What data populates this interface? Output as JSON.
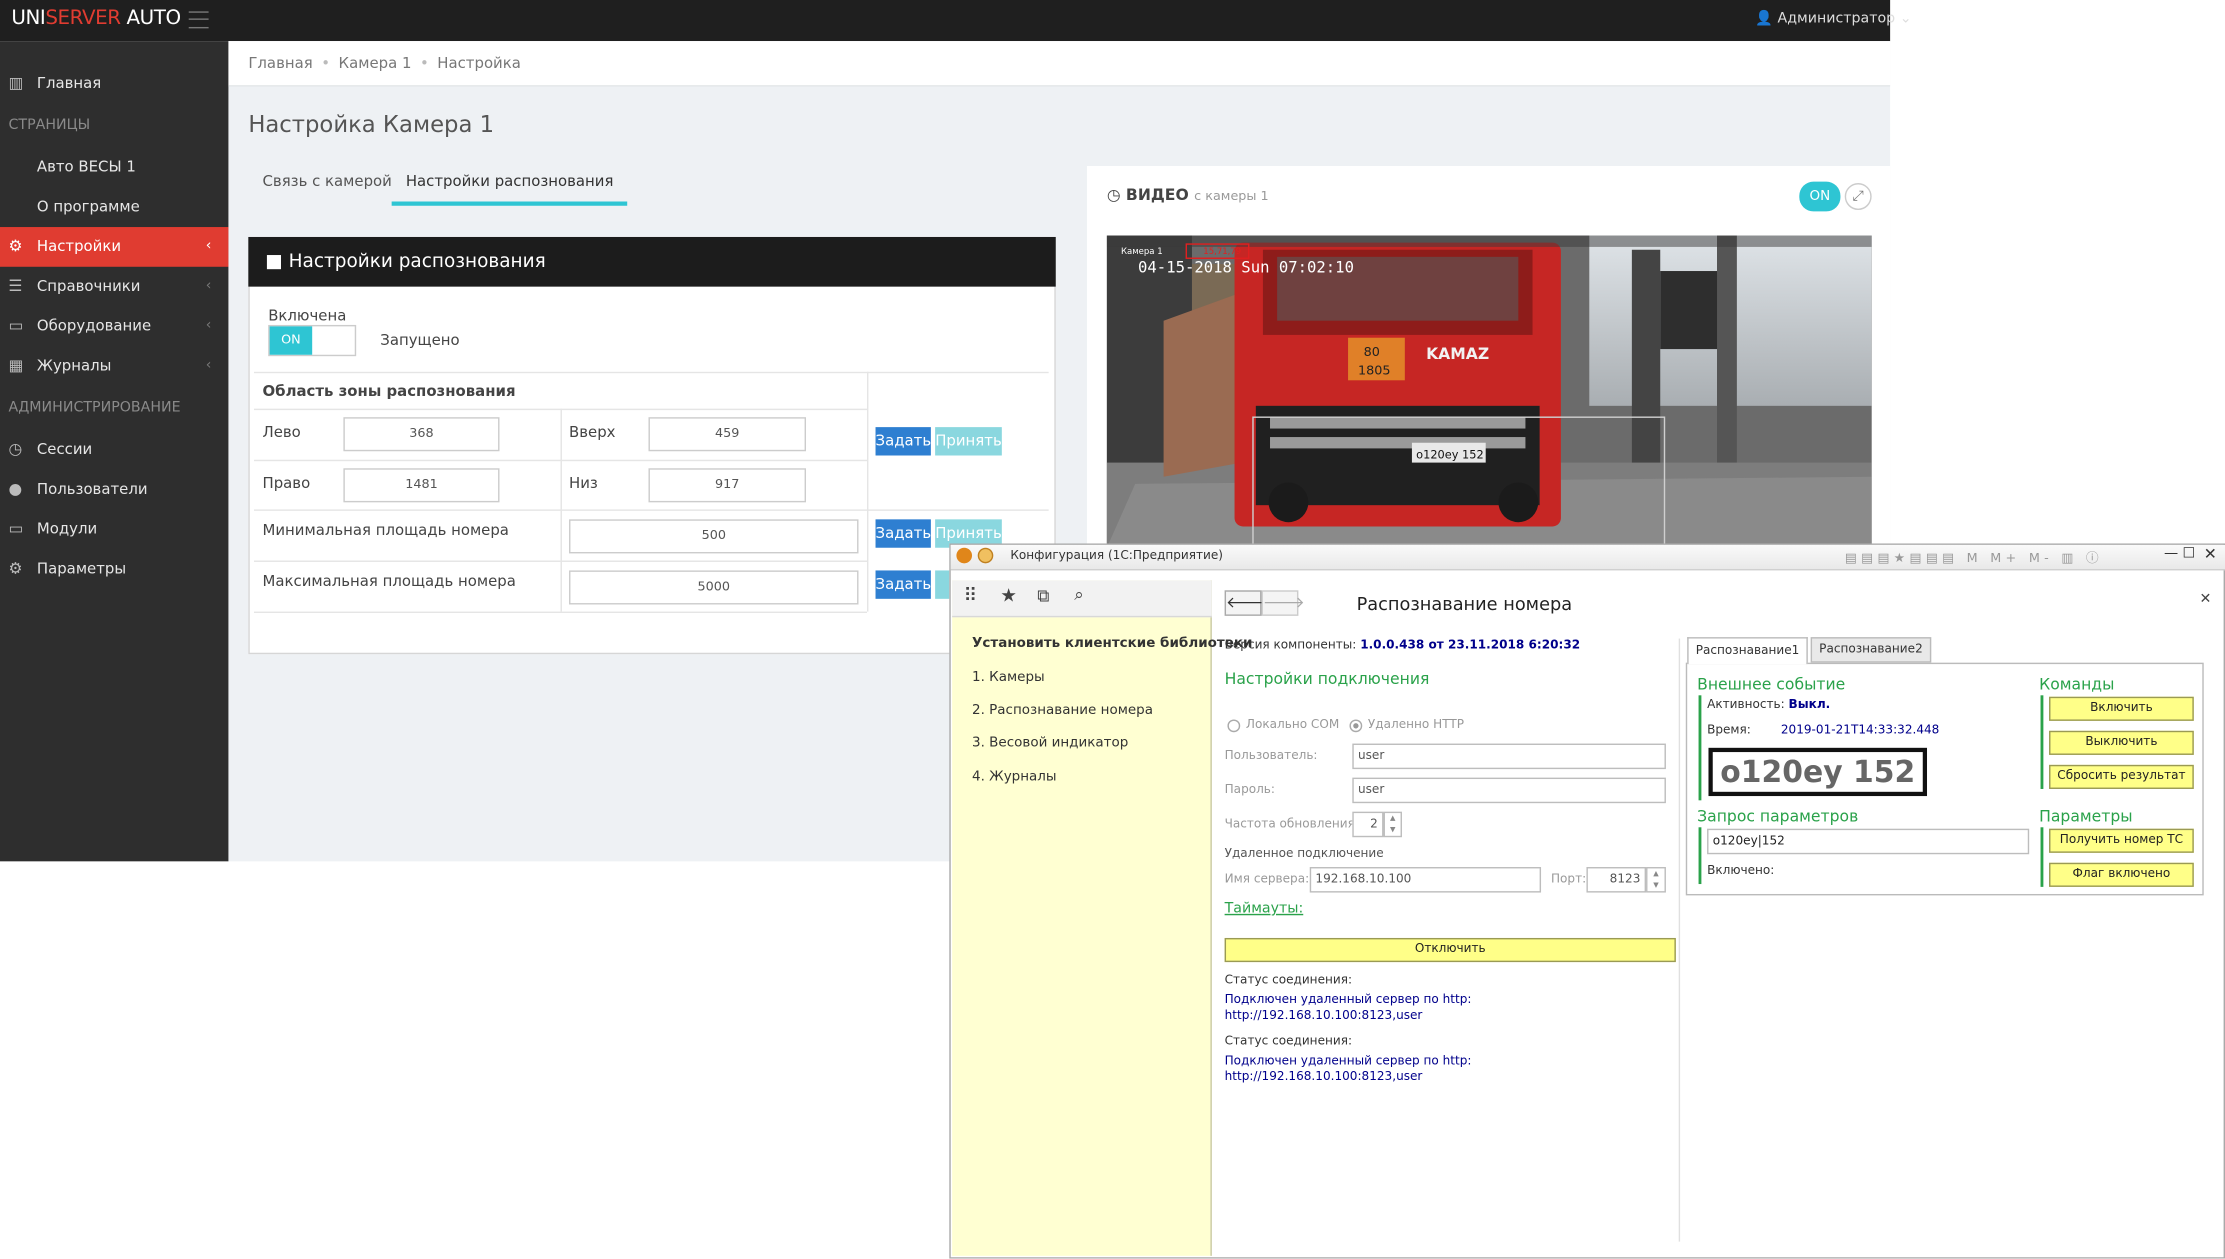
{
  "app": {
    "logo_a": "UNI",
    "logo_b": "SERVER",
    "logo_c": " AUTO",
    "user": "Администратор"
  },
  "sidebar": {
    "items": [
      {
        "label": "Главная",
        "icon": "chart-icon"
      },
      {
        "label": "СТРАНИЦЫ"
      },
      {
        "label": "Авто ВЕСЫ 1"
      },
      {
        "label": "О программе"
      },
      {
        "label": "Настройки",
        "icon": "gear-icon"
      },
      {
        "label": "Справочники",
        "icon": "database-icon"
      },
      {
        "label": "Оборудование",
        "icon": "device-icon"
      },
      {
        "label": "Журналы",
        "icon": "table-icon"
      },
      {
        "label": "АДМИНИСТРИРОВАНИЕ"
      },
      {
        "label": "Сессии",
        "icon": "clock-icon"
      },
      {
        "label": "Пользователи",
        "icon": "user-icon"
      },
      {
        "label": "Модули",
        "icon": "module-icon"
      },
      {
        "label": "Параметры",
        "icon": "gear-icon"
      }
    ]
  },
  "breadcrumb": [
    "Главная",
    "Камера 1",
    "Настройка"
  ],
  "page": {
    "title": "Настройка Камера 1",
    "tabs": [
      "Связь с камерой",
      "Настройки распознования"
    ]
  },
  "recog": {
    "header": "Настройки распознования",
    "enabled_label": "Включена",
    "toggle": "ON",
    "status": "Запущено",
    "zone_title": "Область зоны распознования",
    "left_label": "Лево",
    "left": "368",
    "top_label": "Вверх",
    "top": "459",
    "right_label": "Право",
    "right": "1481",
    "bottom_label": "Низ",
    "bottom": "917",
    "min_label": "Минимальная площадь номера",
    "min": "500",
    "max_label": "Максимальная площадь номера",
    "max": "5000",
    "set": "Задать",
    "apply": "Принять"
  },
  "video": {
    "title": "ВИДЕО",
    "subtitle": "с камеры 1",
    "on": "ON",
    "cam": "Камера 1",
    "stamp": "04-15-2018 Sun 07:02:10",
    "brand": "KAMAZ",
    "haz1": "80",
    "haz2": "1805",
    "plate": "о120еу 152",
    "rtag": "15,71,79"
  },
  "onec": {
    "window_title": "Конфигурация (1С:Предприятие)",
    "nav": [
      "Установить клиентские библиотеки",
      "1. Камеры",
      "2. Распознавание номера",
      "3. Весовой индикатор",
      "4. Журналы"
    ],
    "form_title": "Распознавание номера",
    "version_label": "Версия компоненты:",
    "version": "1.0.0.438 от 23.11.2018 6:20:32",
    "conn_settings": "Настройки подключения",
    "local": "Локально COM",
    "remote": "Удаленно HTTP",
    "user_label": "Пользователь:",
    "user": "user",
    "pass_label": "Пароль:",
    "pass": "user",
    "freq_label": "Частота обновления:",
    "freq": "2",
    "remote_conn": "Удаленное подключение",
    "server_label": "Имя сервера:",
    "server": "192.168.10.100",
    "port_label": "Порт:",
    "port": "8123",
    "timeouts": "Таймауты:",
    "disconnect": "Отключить",
    "status_label": "Статус соединения:",
    "status_l1": "Подключен удаленный сервер по http:",
    "status_l2": "http://192.168.10.100:8123,user",
    "tabs": [
      "Распознавание1",
      "Распознавание2"
    ],
    "ext_event": "Внешнее событие",
    "activity_label": "Активность:",
    "activity": "Выкл.",
    "time_label": "Время:",
    "time": "2019-01-21T14:33:32.448",
    "plate": "о120еу 152",
    "commands": "Команды",
    "btn_on": "Включить",
    "btn_off": "Выключить",
    "btn_reset": "Сбросить результат",
    "params_req": "Запрос параметров",
    "params_val": "о120еу|152",
    "enabled_label": "Включено:",
    "params": "Параметры",
    "btn_getnum": "Получить номер ТС",
    "btn_flag": "Флаг включено"
  }
}
